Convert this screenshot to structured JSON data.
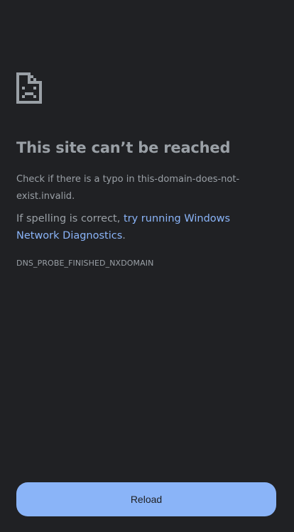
{
  "error": {
    "icon": "broken-page-sad-face-icon",
    "title": "This site can’t be reached",
    "suggestion": "Check if there is a typo in this-domain-does-not-exist.invalid.",
    "diagnostics_prefix": "If spelling is correct, ",
    "diagnostics_link": "try running Windows Network Diagnostics",
    "diagnostics_suffix": ".",
    "code": "DNS_PROBE_FINISHED_NXDOMAIN"
  },
  "reload_button": {
    "label": "Reload"
  },
  "colors": {
    "background": "#202124",
    "text": "#9aa0a6",
    "link": "#8ab4f8",
    "button": "#8ab4f8",
    "button_text": "#202124"
  }
}
